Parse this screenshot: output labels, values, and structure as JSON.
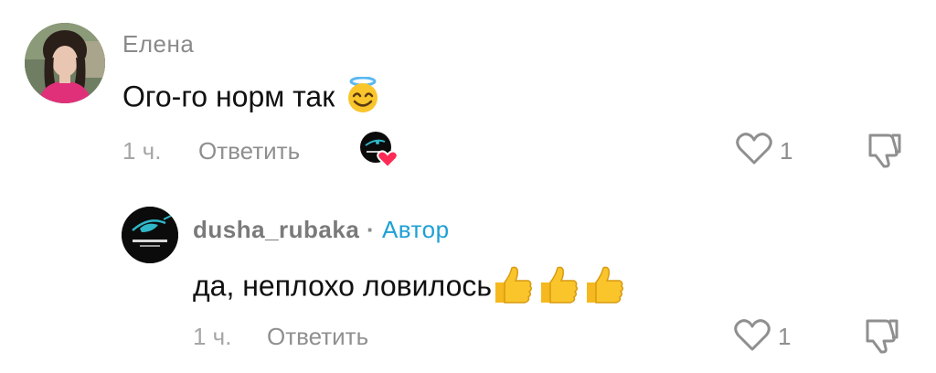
{
  "comments": [
    {
      "author": "Елена",
      "text": "Ого-го норм так",
      "emoji": "smiling-face-with-halo",
      "time": "1 ч.",
      "reply_label": "Ответить",
      "likes": "1",
      "liked_by_author": true
    },
    {
      "author": "dusha_rubaka",
      "separator": "·",
      "badge": "Автор",
      "text": "да, неплохо ловилось",
      "emoji": "thumbs-up",
      "emoji_count": 3,
      "time": "1 ч.",
      "reply_label": "Ответить",
      "likes": "1"
    }
  ],
  "colors": {
    "badge": "#1ea0d6",
    "heart_badge": "#ff2a55",
    "muted": "#8f8f8f"
  }
}
